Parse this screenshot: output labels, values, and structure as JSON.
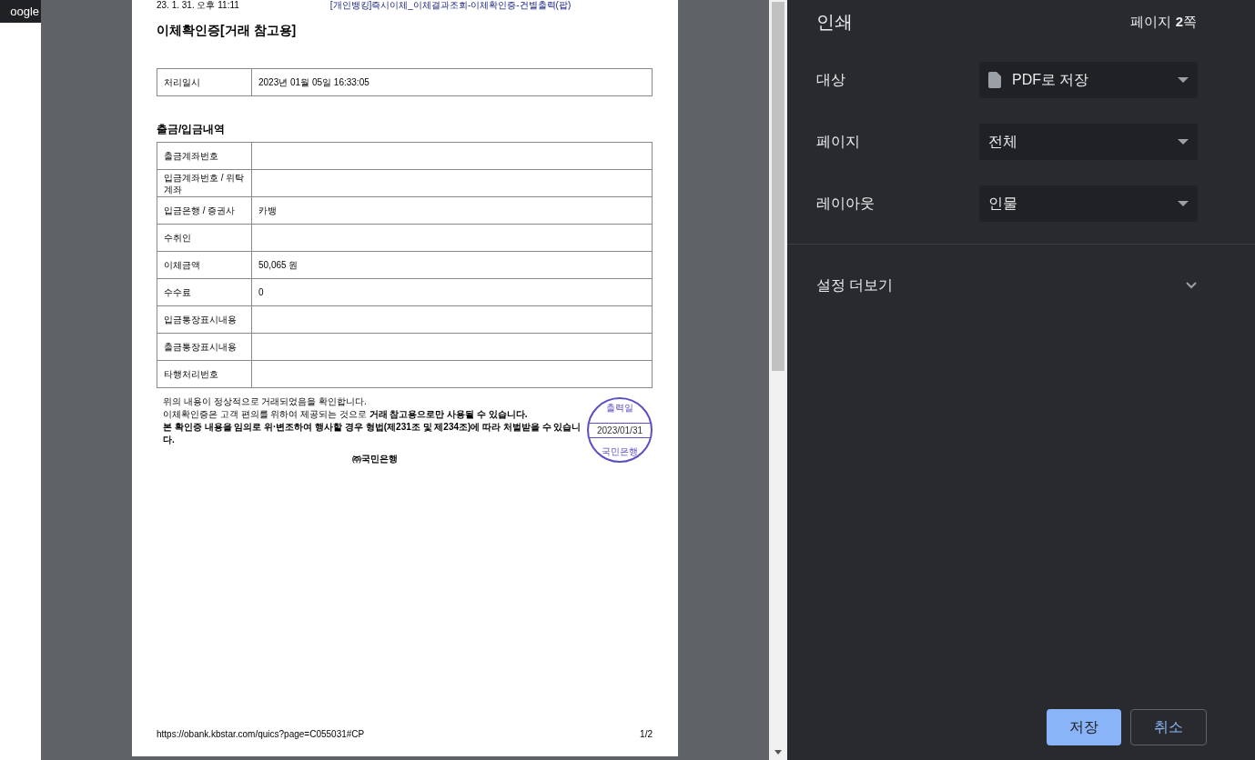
{
  "background": {
    "tab_text": "oogle"
  },
  "document": {
    "header_left": "23. 1. 31. 오후 11:11",
    "header_center": "[개인뱅킹]즉시이체_이체결과조회-이체확인증-건별출력(팝)",
    "title": "이체확인증[거래 참고용]",
    "time_table": [
      {
        "label": "처리일시",
        "value": "2023년 01월 05일   16:33:05"
      }
    ],
    "section_title": "출금/입금내역",
    "rows": [
      {
        "label": "출금계좌번호"
      },
      {
        "label": "입금계좌번호 / 위탁계좌"
      },
      {
        "label": "입금은행 / 증권사",
        "value": "카뱅"
      },
      {
        "label": "수취인"
      },
      {
        "label": "이체금액",
        "value": "50,065 원"
      },
      {
        "label": "수수료",
        "value": "0"
      },
      {
        "label": "입금통장표시내용"
      },
      {
        "label": "출금통장표시내용"
      },
      {
        "label": "타행처리번호"
      }
    ],
    "notes": [
      "위의 내용이 정상적으로 거래되었음을 확인합니다.",
      "이체확인증은 고객 편의를 위하여 제공되는 것으로 **거래 참고용으로만 사용될 수 있습니다.**",
      "**본 확인증 내용을 임의로 위·변조하여 행사할 경우 형법(제231조 및 제234조)에 따라 처벌받을 수 있습니다.**"
    ],
    "issuer": "㈜국민은행",
    "stamp": {
      "top": "출력일",
      "date": "2023/01/31",
      "bottom": "국민은행"
    },
    "footer_url": "https://obank.kbstar.com/quics?page=C055031#CP",
    "footer_page": "1/2"
  },
  "print_panel": {
    "title": "인쇄",
    "page_count": "페이지 **2**쪽",
    "settings": [
      {
        "label": "대상",
        "value": "PDF로 저장",
        "kind": "file"
      },
      {
        "label": "페이지",
        "value": "전체",
        "kind": "plain"
      },
      {
        "label": "레이아웃",
        "value": "인물",
        "kind": "plain"
      }
    ],
    "more_settings": "설정 더보기",
    "expanded": false,
    "buttons": [
      {
        "label": "저장",
        "kind": "primary"
      },
      {
        "label": "취소",
        "kind": "secondary"
      }
    ]
  }
}
